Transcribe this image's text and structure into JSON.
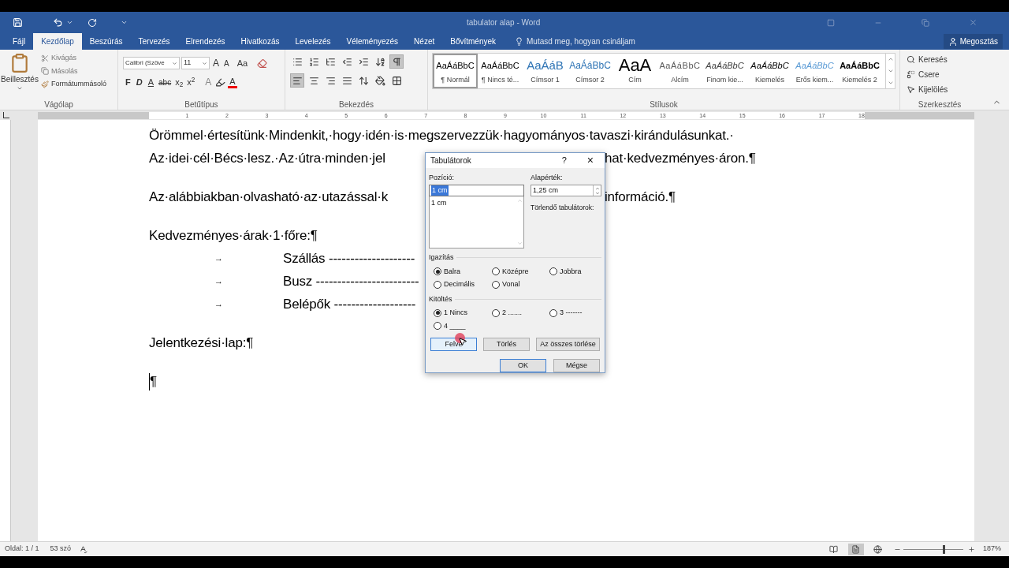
{
  "window": {
    "title": "tabulator alap - Word"
  },
  "tabs": [
    {
      "label": "Fájl",
      "selected": false
    },
    {
      "label": "Kezdőlap",
      "selected": true
    },
    {
      "label": "Beszúrás",
      "selected": false
    },
    {
      "label": "Tervezés",
      "selected": false
    },
    {
      "label": "Elrendezés",
      "selected": false
    },
    {
      "label": "Hivatkozás",
      "selected": false
    },
    {
      "label": "Levelezés",
      "selected": false
    },
    {
      "label": "Véleményezés",
      "selected": false
    },
    {
      "label": "Nézet",
      "selected": false
    },
    {
      "label": "Bővítmények",
      "selected": false
    }
  ],
  "tell_me": {
    "placeholder": "Mutasd meg, hogyan csináljam"
  },
  "share": "Megosztás",
  "clipboard": {
    "paste": "Beillesztés",
    "cut": "Kivágás",
    "copy": "Másolás",
    "painter": "Formátummásoló",
    "label": "Vágólap"
  },
  "font": {
    "name": "Calibri (Szöve",
    "size": "11",
    "label": "Betűtípus",
    "top": [
      {
        "kind": "grow",
        "label": "A"
      },
      {
        "kind": "shrink",
        "label": "A"
      },
      {
        "kind": "case",
        "label": "Aa"
      },
      {
        "kind": "clear"
      }
    ],
    "format": [
      {
        "kind": "bold",
        "label": "F"
      },
      {
        "kind": "italic",
        "label": "D"
      },
      {
        "kind": "underline",
        "label": "A"
      },
      {
        "kind": "strike",
        "label": "abc"
      },
      {
        "kind": "sub",
        "label": "x$_{2}$"
      },
      {
        "kind": "sup",
        "label": "x$^{2}$"
      },
      {
        "kind": "effects",
        "label": "A"
      },
      {
        "kind": "highlight"
      },
      {
        "kind": "color",
        "label": "A"
      }
    ]
  },
  "paragraph": {
    "label": "Bekezdés",
    "top": [
      {
        "kind": "bullets",
        "selected": false
      },
      {
        "kind": "numbering",
        "selected": false
      },
      {
        "kind": "multilevel",
        "selected": false
      },
      {
        "kind": "outdent",
        "selected": false
      },
      {
        "kind": "indent",
        "selected": false
      },
      {
        "kind": "sort",
        "selected": false
      },
      {
        "kind": "marks",
        "selected": true
      }
    ],
    "bottom": [
      {
        "kind": "left",
        "selected": true
      },
      {
        "kind": "center",
        "selected": false
      },
      {
        "kind": "right",
        "selected": false
      },
      {
        "kind": "justify",
        "selected": false
      },
      {
        "kind": "spacing",
        "selected": false
      },
      {
        "kind": "shading",
        "selected": false
      },
      {
        "kind": "borders",
        "selected": false
      }
    ]
  },
  "styles": {
    "label": "Stílusok",
    "items": [
      {
        "kind": "normal",
        "preview": "AaÁáBbC",
        "label": "¶ Normál",
        "selected": true
      },
      {
        "kind": "normal",
        "preview": "AaÁáBbC",
        "label": "¶ Nincs té...",
        "selected": false
      },
      {
        "kind": "heading1",
        "preview": "AaÁáB",
        "label": "Címsor 1",
        "selected": false
      },
      {
        "kind": "heading2",
        "preview": "AaÁáBbC",
        "label": "Címsor 2",
        "selected": false
      },
      {
        "kind": "title",
        "preview": "AaA",
        "label": "Cím",
        "selected": false
      },
      {
        "kind": "subtitle",
        "preview": "AaÁáBbC",
        "label": "Alcím",
        "selected": false
      },
      {
        "kind": "subtle",
        "preview": "AaÁáBbC",
        "label": "Finom kie...",
        "selected": false
      },
      {
        "kind": "emphasis",
        "preview": "AaÁáBbC",
        "label": "Kiemelés",
        "selected": false
      },
      {
        "kind": "intense",
        "preview": "AaÁáBbC",
        "label": "Erős kiem...",
        "selected": false
      },
      {
        "kind": "strong",
        "preview": "AaÁáBbC",
        "label": "Kiemelés 2",
        "selected": false
      }
    ]
  },
  "editing": {
    "label": "Szerkesztés",
    "items": [
      {
        "kind": "find",
        "label": "Keresés"
      },
      {
        "kind": "replace",
        "label": "Csere"
      },
      {
        "kind": "select",
        "label": "Kijelölés"
      }
    ]
  },
  "ruler": [
    "1",
    "2",
    "3",
    "4",
    "5",
    "6",
    "7",
    "8",
    "9",
    "10",
    "11",
    "12",
    "13",
    "14",
    "15",
    "16",
    "17",
    "18"
  ],
  "document": [
    {
      "lines": [
        {
          "kind": "full",
          "text": "Örömmel·értesítünk·Mindenkit,·hogy·idén·is·megszervezzük·hagyományos·tavaszi·kirándulásunkat.·"
        },
        {
          "kind": "split",
          "left": "Az·idei·cél·Bécs·lesz.·Az·útra·minden·jel",
          "right": "hat·kedvezményes·áron.¶"
        }
      ]
    },
    {
      "lines": [
        {
          "kind": "split",
          "left": "Az·alábbiakban·olvasható·az·utazással·k",
          "right": "információ.¶"
        }
      ]
    },
    {
      "lines": [
        {
          "kind": "full",
          "text": "Kedvezményes·árak·1·főre:¶"
        },
        {
          "kind": "tab",
          "tab": "→",
          "text": "Szállás --------------------"
        },
        {
          "kind": "tab",
          "tab": "→",
          "text": "Busz ------------------------"
        },
        {
          "kind": "tab",
          "tab": "→",
          "text": "Belépők -------------------"
        }
      ]
    },
    {
      "lines": [
        {
          "kind": "full",
          "text": "Jelentkezési·lap:¶"
        }
      ]
    },
    {
      "lines": [
        {
          "kind": "caret",
          "text": "¶"
        }
      ]
    }
  ],
  "dialog": {
    "title": "Tabulátorok",
    "help": "?",
    "close": "×",
    "position_label": "Pozíció:",
    "position_value": "1 cm",
    "positions": [
      "1 cm"
    ],
    "default_label": "Alapérték:",
    "default_value": "1,25 cm",
    "clear_label": "Törlendő tabulátorok:",
    "alignment": {
      "label": "Igazítás",
      "options": [
        {
          "label": "Balra",
          "selected": true
        },
        {
          "label": "Középre",
          "selected": false
        },
        {
          "label": "Jobbra",
          "selected": false
        },
        {
          "label": "Decimális",
          "selected": false
        },
        {
          "label": "Vonal",
          "selected": false
        }
      ]
    },
    "leader": {
      "label": "Kitöltés",
      "options": [
        {
          "label": "1 Nincs",
          "selected": true
        },
        {
          "label": "2 .......",
          "selected": false
        },
        {
          "label": "3 -------",
          "selected": false
        },
        {
          "label": "4 ____",
          "selected": false
        }
      ]
    },
    "buttons": [
      "Felvé",
      "Törlés",
      "Az összes törlése"
    ],
    "ok": "OK",
    "cancel": "Mégse"
  },
  "status": {
    "page": "Oldal: 1 / 1",
    "words": "53 szó",
    "views": [
      {
        "kind": "read",
        "selected": false
      },
      {
        "kind": "print",
        "selected": true
      },
      {
        "kind": "web",
        "selected": false
      }
    ],
    "zoom": {
      "level": 0.66,
      "reading": "187%"
    }
  }
}
